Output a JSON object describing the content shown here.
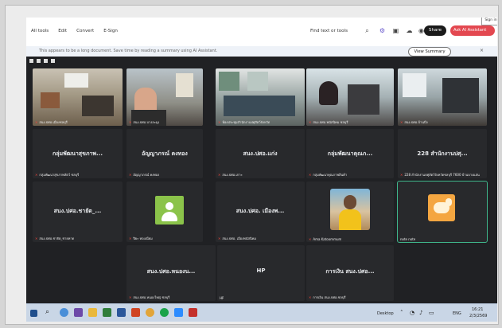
{
  "acrobat": {
    "menu": [
      "All tools",
      "Edit",
      "Convert",
      "E-Sign"
    ],
    "find": "Find text or tools",
    "share": "Share",
    "ask_ai": "Ask AI Assistant",
    "sign_tab": "Sign in",
    "notice": "This appears to be a long document. Save time by reading a summary using AI Assistant.",
    "view_summary": "View Summary",
    "close": "×"
  },
  "meet": {
    "video_tiles": [
      {
        "name": "สนง.ปศอ.เมืองชลบุรี"
      },
      {
        "name": "สนง.ปศอ.บางละมุง"
      },
      {
        "name": "ห้องประชุมสำนักงานปศุสัตว์จังหวัด"
      },
      {
        "name": "สนง.ปศอ.พนัสนิคม ชลบุรี"
      },
      {
        "name": "สนง.ปศอ.บ้านบึง"
      }
    ],
    "row2": [
      {
        "big": "กลุ่มพัฒนาสุขภาพ...",
        "name": "กลุ่มพัฒนาสุขภาพสัตว์ ชลบุรี"
      },
      {
        "big": "อัญญาภรณ์ คงทอง",
        "name": "อัญญาภรณ์ คงทอง"
      },
      {
        "big": "สนง.ปศอ.แก่ง",
        "name": "สนง.ปศอ.เกาะ"
      },
      {
        "big": "กลุ่มพัฒนาคุณภ...",
        "name": "กลุ่มพัฒนาคุณภาพสินค้า"
      },
      {
        "big": "228 สำนักงานปศุ...",
        "name": "228 สำนักงานปศุสัตว์จังหวัดชลบุรี 7600 บ้านบางแสน"
      }
    ],
    "row3": [
      {
        "big": "สนง.ปศอ.ชายัต_...",
        "name": "สนง.ปศอ.ชายัต_ชายหาด"
      },
      {
        "big": "",
        "name": "ปิยะ ทองเนียม"
      },
      {
        "big": "สนง.ปศอ. เมืองพ...",
        "name": "สนง.ปศอ. เมืองพนัสนิคม"
      },
      {
        "big": "",
        "name": "Ama Katoommum"
      },
      {
        "big": "",
        "name": "note note"
      }
    ],
    "row4": [
      {
        "big": "สนง.ปศอ.หนองน...",
        "name": "สนง.ปศอ.หนองใหญ่ ชลบุรี"
      },
      {
        "big": "HP",
        "name": "HP"
      },
      {
        "big": "การเงิน สนง.ปศอ...",
        "name": "การเงิน สนง.ปศอ.ชลบุรี"
      }
    ]
  },
  "taskbar": {
    "desktop": "Desktop",
    "lang": "ENG",
    "time": "16:21",
    "date": "2/3/2569"
  }
}
